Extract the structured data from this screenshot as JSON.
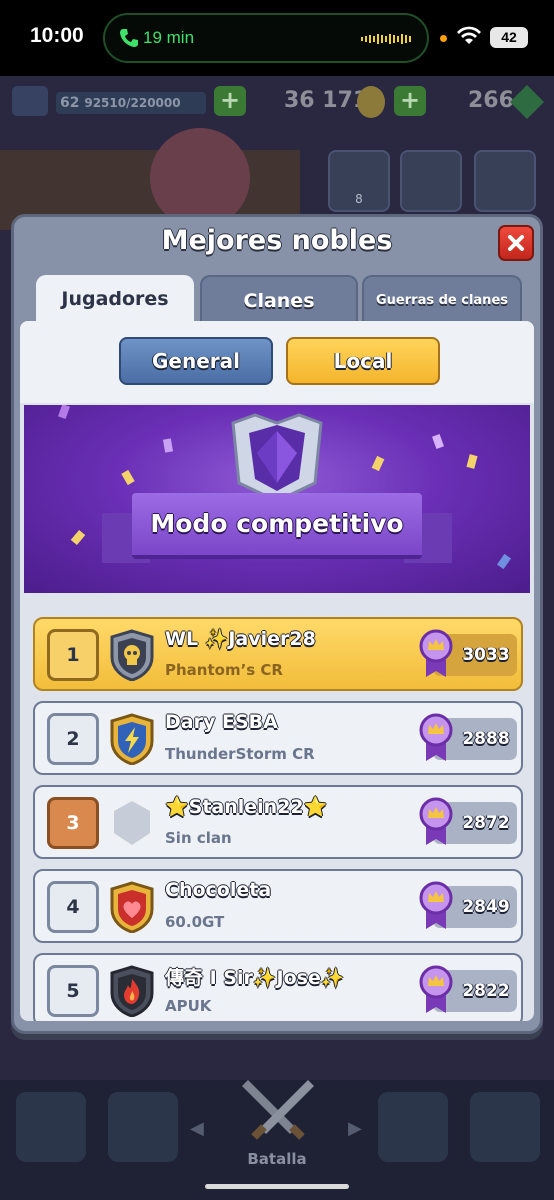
{
  "status_bar": {
    "time": "10:00",
    "call_duration": "19 min",
    "battery": "42"
  },
  "hud": {
    "level": "62",
    "xp": "92510/220000",
    "gold": "36 171",
    "gems": "266"
  },
  "side_buttons": {
    "friends_count": "8"
  },
  "modal": {
    "title": "Mejores nobles",
    "tabs": [
      {
        "label": "Jugadores",
        "active": true
      },
      {
        "label": "Clanes",
        "active": false
      },
      {
        "label": "Guerras de clanes",
        "active": false
      }
    ],
    "scope": {
      "general_label": "General",
      "local_label": "Local",
      "selected": "Local"
    },
    "banner_title": "Modo competitivo",
    "rows": [
      {
        "rank": "1",
        "name": "WL ✨Javier28",
        "clan": "Phantom’s CR",
        "trophies": "3033",
        "badge_icon": "skull-shield-icon"
      },
      {
        "rank": "2",
        "name": "Dary ESBA",
        "clan": "ThunderStorm CR",
        "trophies": "2888",
        "badge_icon": "lightning-shield-icon"
      },
      {
        "rank": "3",
        "name": "⭐Stanlein22⭐",
        "clan": "Sin clan",
        "trophies": "2872",
        "badge_icon": "empty-shield-icon"
      },
      {
        "rank": "4",
        "name": "Chocoleta",
        "clan": "60.0GT",
        "trophies": "2849",
        "badge_icon": "heart-shield-icon"
      },
      {
        "rank": "5",
        "name": "傳奇 I Sir✨Jose✨",
        "clan": "APUK",
        "trophies": "2822",
        "badge_icon": "flame-shield-icon"
      }
    ]
  },
  "bottom_nav": {
    "battle_label": "Batalla"
  },
  "colors": {
    "accent_gold": "#f4b52d",
    "accent_blue": "#4a6ea5",
    "close_red": "#d8342a",
    "banner_purple": "#6a2fb6"
  }
}
